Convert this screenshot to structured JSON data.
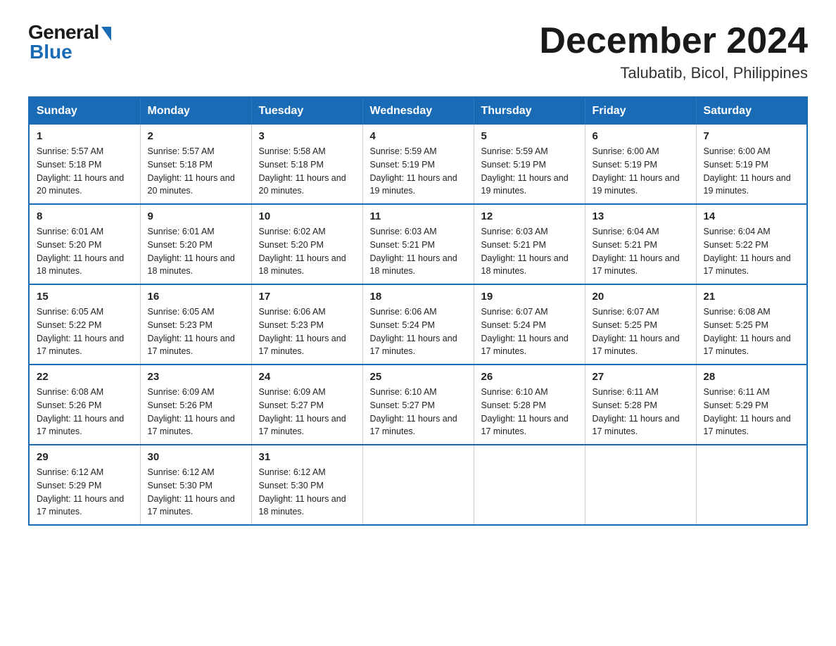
{
  "logo": {
    "general": "General",
    "blue": "Blue"
  },
  "title": {
    "month_year": "December 2024",
    "location": "Talubatib, Bicol, Philippines"
  },
  "days_of_week": [
    "Sunday",
    "Monday",
    "Tuesday",
    "Wednesday",
    "Thursday",
    "Friday",
    "Saturday"
  ],
  "weeks": [
    [
      {
        "day": "1",
        "sunrise": "5:57 AM",
        "sunset": "5:18 PM",
        "daylight": "11 hours and 20 minutes."
      },
      {
        "day": "2",
        "sunrise": "5:57 AM",
        "sunset": "5:18 PM",
        "daylight": "11 hours and 20 minutes."
      },
      {
        "day": "3",
        "sunrise": "5:58 AM",
        "sunset": "5:18 PM",
        "daylight": "11 hours and 20 minutes."
      },
      {
        "day": "4",
        "sunrise": "5:59 AM",
        "sunset": "5:19 PM",
        "daylight": "11 hours and 19 minutes."
      },
      {
        "day": "5",
        "sunrise": "5:59 AM",
        "sunset": "5:19 PM",
        "daylight": "11 hours and 19 minutes."
      },
      {
        "day": "6",
        "sunrise": "6:00 AM",
        "sunset": "5:19 PM",
        "daylight": "11 hours and 19 minutes."
      },
      {
        "day": "7",
        "sunrise": "6:00 AM",
        "sunset": "5:19 PM",
        "daylight": "11 hours and 19 minutes."
      }
    ],
    [
      {
        "day": "8",
        "sunrise": "6:01 AM",
        "sunset": "5:20 PM",
        "daylight": "11 hours and 18 minutes."
      },
      {
        "day": "9",
        "sunrise": "6:01 AM",
        "sunset": "5:20 PM",
        "daylight": "11 hours and 18 minutes."
      },
      {
        "day": "10",
        "sunrise": "6:02 AM",
        "sunset": "5:20 PM",
        "daylight": "11 hours and 18 minutes."
      },
      {
        "day": "11",
        "sunrise": "6:03 AM",
        "sunset": "5:21 PM",
        "daylight": "11 hours and 18 minutes."
      },
      {
        "day": "12",
        "sunrise": "6:03 AM",
        "sunset": "5:21 PM",
        "daylight": "11 hours and 18 minutes."
      },
      {
        "day": "13",
        "sunrise": "6:04 AM",
        "sunset": "5:21 PM",
        "daylight": "11 hours and 17 minutes."
      },
      {
        "day": "14",
        "sunrise": "6:04 AM",
        "sunset": "5:22 PM",
        "daylight": "11 hours and 17 minutes."
      }
    ],
    [
      {
        "day": "15",
        "sunrise": "6:05 AM",
        "sunset": "5:22 PM",
        "daylight": "11 hours and 17 minutes."
      },
      {
        "day": "16",
        "sunrise": "6:05 AM",
        "sunset": "5:23 PM",
        "daylight": "11 hours and 17 minutes."
      },
      {
        "day": "17",
        "sunrise": "6:06 AM",
        "sunset": "5:23 PM",
        "daylight": "11 hours and 17 minutes."
      },
      {
        "day": "18",
        "sunrise": "6:06 AM",
        "sunset": "5:24 PM",
        "daylight": "11 hours and 17 minutes."
      },
      {
        "day": "19",
        "sunrise": "6:07 AM",
        "sunset": "5:24 PM",
        "daylight": "11 hours and 17 minutes."
      },
      {
        "day": "20",
        "sunrise": "6:07 AM",
        "sunset": "5:25 PM",
        "daylight": "11 hours and 17 minutes."
      },
      {
        "day": "21",
        "sunrise": "6:08 AM",
        "sunset": "5:25 PM",
        "daylight": "11 hours and 17 minutes."
      }
    ],
    [
      {
        "day": "22",
        "sunrise": "6:08 AM",
        "sunset": "5:26 PM",
        "daylight": "11 hours and 17 minutes."
      },
      {
        "day": "23",
        "sunrise": "6:09 AM",
        "sunset": "5:26 PM",
        "daylight": "11 hours and 17 minutes."
      },
      {
        "day": "24",
        "sunrise": "6:09 AM",
        "sunset": "5:27 PM",
        "daylight": "11 hours and 17 minutes."
      },
      {
        "day": "25",
        "sunrise": "6:10 AM",
        "sunset": "5:27 PM",
        "daylight": "11 hours and 17 minutes."
      },
      {
        "day": "26",
        "sunrise": "6:10 AM",
        "sunset": "5:28 PM",
        "daylight": "11 hours and 17 minutes."
      },
      {
        "day": "27",
        "sunrise": "6:11 AM",
        "sunset": "5:28 PM",
        "daylight": "11 hours and 17 minutes."
      },
      {
        "day": "28",
        "sunrise": "6:11 AM",
        "sunset": "5:29 PM",
        "daylight": "11 hours and 17 minutes."
      }
    ],
    [
      {
        "day": "29",
        "sunrise": "6:12 AM",
        "sunset": "5:29 PM",
        "daylight": "11 hours and 17 minutes."
      },
      {
        "day": "30",
        "sunrise": "6:12 AM",
        "sunset": "5:30 PM",
        "daylight": "11 hours and 17 minutes."
      },
      {
        "day": "31",
        "sunrise": "6:12 AM",
        "sunset": "5:30 PM",
        "daylight": "11 hours and 18 minutes."
      },
      null,
      null,
      null,
      null
    ]
  ]
}
